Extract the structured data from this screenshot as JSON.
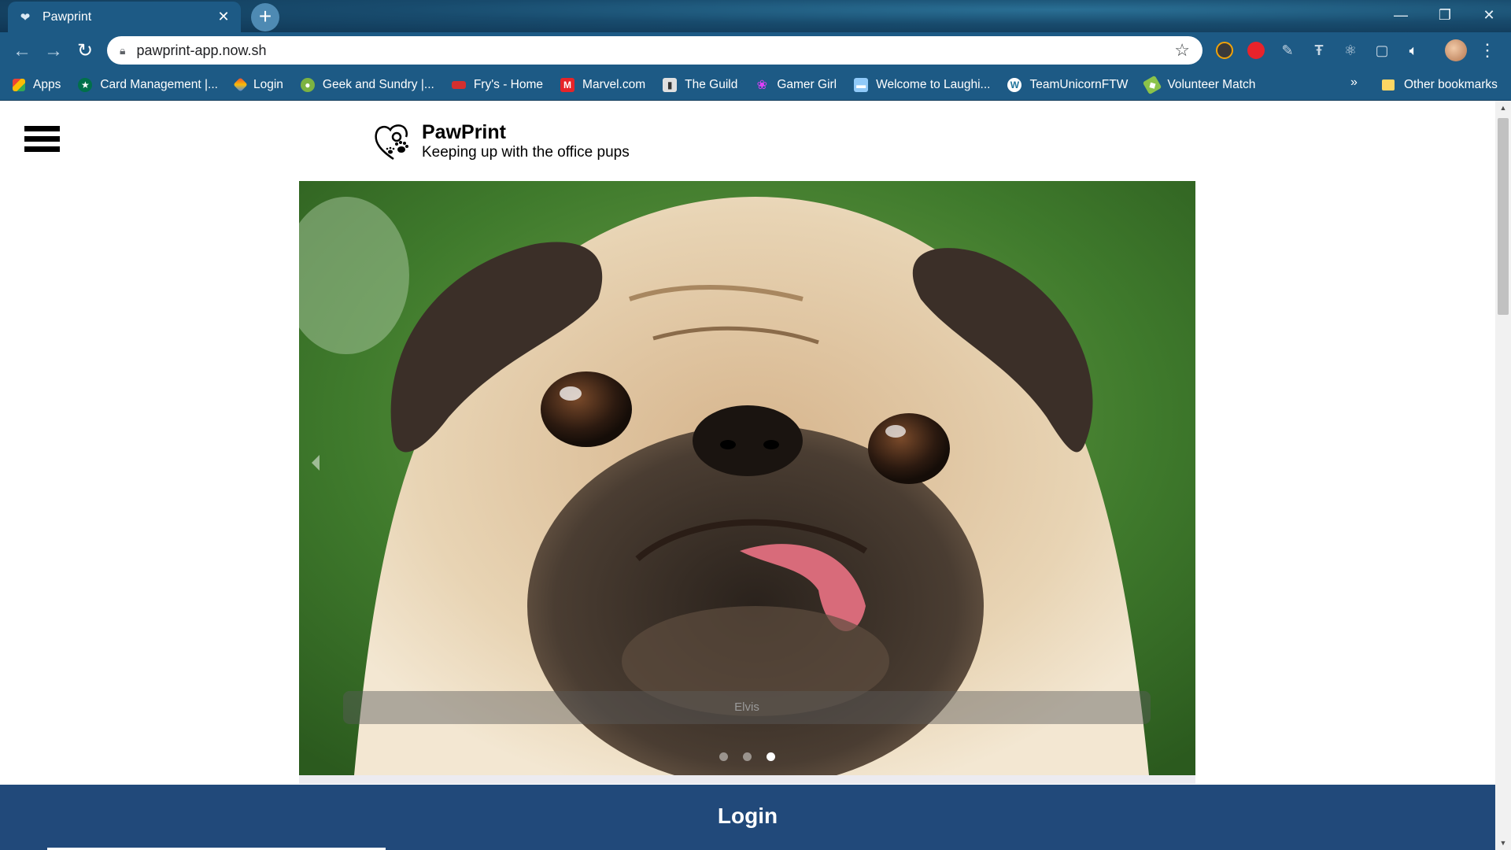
{
  "browser": {
    "tab_title": "Pawprint",
    "tab_close": "✕",
    "new_tab": "+",
    "window_controls": {
      "minimize": "—",
      "restore": "❐",
      "close": "✕"
    },
    "nav": {
      "back": "←",
      "forward": "→",
      "reload": "↻"
    },
    "url": "pawprint-app.now.sh",
    "bookmark_star": "☆",
    "bookmarks": [
      {
        "label": "Apps",
        "icon": "apps-grid-icon"
      },
      {
        "label": "Card Management |...",
        "icon": "starbucks-icon"
      },
      {
        "label": "Login",
        "icon": "diamond-icon"
      },
      {
        "label": "Geek and Sundry |...",
        "icon": "geek-sundry-icon"
      },
      {
        "label": "Fry's - Home",
        "icon": "frys-icon"
      },
      {
        "label": "Marvel.com",
        "icon": "marvel-icon"
      },
      {
        "label": "The Guild",
        "icon": "the-guild-icon"
      },
      {
        "label": "Gamer Girl",
        "icon": "gamer-girl-icon"
      },
      {
        "label": "Welcome to Laughi...",
        "icon": "laughing-icon"
      },
      {
        "label": "TeamUnicornFTW",
        "icon": "wordpress-icon"
      },
      {
        "label": "Volunteer Match",
        "icon": "volunteer-icon"
      }
    ],
    "bookmarks_more": "»",
    "other_bookmarks": "Other bookmarks",
    "menu_dots": "⋮"
  },
  "page": {
    "brand_title": "PawPrint",
    "brand_tagline": "Keeping up with the office pups",
    "carousel": {
      "caption": "Elvis",
      "slide_count": 3,
      "active_slide": 3
    },
    "login_label": "Login"
  },
  "colors": {
    "chrome": "#1d5a85",
    "login_bar": "#21497a",
    "active_tab": "#1d5a85"
  }
}
